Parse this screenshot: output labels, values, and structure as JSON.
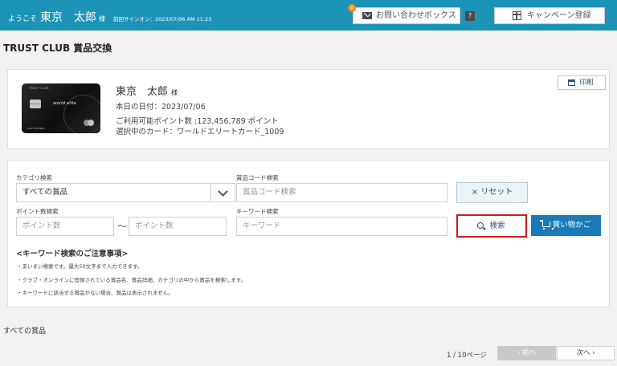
{
  "header": {
    "welcome_prefix": "ようこそ",
    "user_name": "東京　太郎",
    "honorific": "様",
    "last_signin": "前回サインオン：2023/07/06 AM 11:23",
    "contact_badge": "0",
    "contact_label": "お問い合わせボックス",
    "help_label": "?",
    "campaign_label": "キャンペーン登録",
    "brand_color": "#1d93b8"
  },
  "page_title": "TRUST CLUB 賞品交換",
  "member": {
    "card_brand": "TRUST CLUB",
    "card_title": "world elite",
    "card_holder": "CARD MEMBER",
    "name": "東京　太郎",
    "honorific": "様",
    "date_line": "本日の日付：2023/07/06",
    "points_line": "ご利用可能ポイント数 :123,456,789 ポイント",
    "card_line": "選択中のカード：ワールドエリートカード_1009",
    "print_label": "印刷"
  },
  "search": {
    "category_label": "カテゴリ検索",
    "category_value": "すべての賞品",
    "code_label": "賞品コード検索",
    "code_placeholder": "賞品コード検索",
    "points_label": "ポイント数検索",
    "points_from_placeholder": "ポイント数",
    "points_separator": "～",
    "points_to_placeholder": "ポイント数",
    "keyword_label": "キーワード検索",
    "keyword_placeholder": "キーワード",
    "reset_label": "× リセット",
    "search_label": "検索",
    "cart_label": "買い物かご",
    "cart_color": "#1a7aba",
    "highlight_color": "#d01b1b"
  },
  "notes": {
    "title": "<キーワード検索のご注意事項>",
    "items": [
      "・あいまい検索です。最大50文字まで入力できます。",
      "・クラブ・オンラインに登録されている賞品名、賞品詳細、カテゴリの中から賞品を検索します。",
      "・キーワードに該当する賞品がない場合、賞品は表示されません。"
    ]
  },
  "results": {
    "category_heading": "すべての賞品",
    "page_info": "1 / 10ページ",
    "prev_label": "‹ 前へ",
    "next_label": "次へ ›"
  }
}
